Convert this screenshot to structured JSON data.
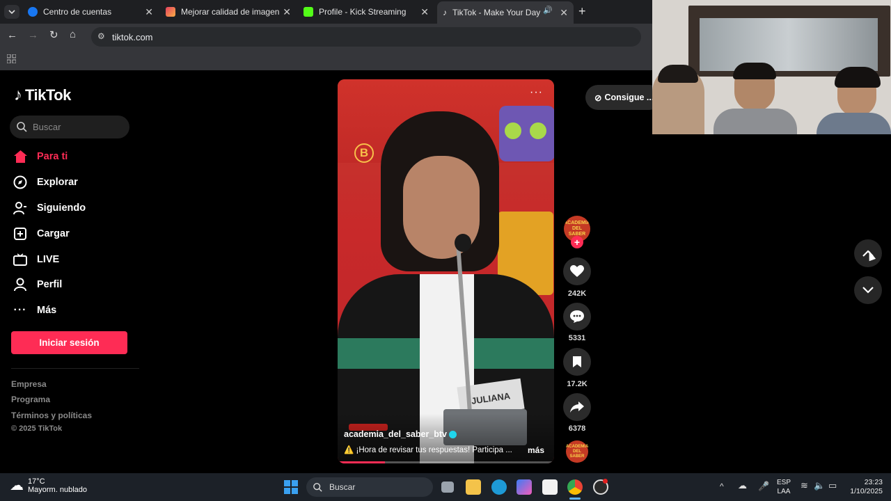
{
  "browser": {
    "tabs": [
      {
        "title": "Centro de cuentas",
        "favicon_color": "#1877f2"
      },
      {
        "title": "Mejorar calidad de imagen onli",
        "favicon_color": "#e4405f"
      },
      {
        "title": "Profile - Kick Streaming",
        "favicon_color": "#53fc18"
      },
      {
        "title": "TikTok - Make Your Day",
        "favicon_color": "#ffffff"
      }
    ],
    "new_tab": "+",
    "url": "tiktok.com"
  },
  "tiktok": {
    "logo_text": "TikTok",
    "search_placeholder": "Buscar",
    "nav": [
      {
        "label": "Para ti",
        "icon": "home-icon",
        "active": true
      },
      {
        "label": "Explorar",
        "icon": "compass-icon"
      },
      {
        "label": "Siguiendo",
        "icon": "user-follow-icon"
      },
      {
        "label": "Cargar",
        "icon": "upload-icon"
      },
      {
        "label": "LIVE",
        "icon": "live-tv-icon"
      },
      {
        "label": "Perfil",
        "icon": "profile-icon"
      },
      {
        "label": "Más",
        "icon": "more-icon"
      }
    ],
    "login_button": "Iniciar sesión",
    "footer": [
      "Empresa",
      "Programa",
      "Términos y políticas",
      "© 2025 TikTok"
    ],
    "get_app": "Consigue ...",
    "accent": "#fe2c55"
  },
  "video": {
    "username": "academia_del_saber_btv",
    "caption": "⚠️ ¡Hora de revisar tus respuestas! Participa ...",
    "more": "más",
    "badge_text": "ACADEMIA DEL SABER",
    "name_tag": "JULIANA",
    "likes": "242K",
    "comments": "5331",
    "saves": "17.2K",
    "shares": "6378"
  },
  "taskbar": {
    "weather_temp": "17°C",
    "weather_desc": "Mayorm. nublado",
    "search": "Buscar",
    "lang": "ESP",
    "lang2": "LAA",
    "time": "23:23",
    "date": "1/10/2025"
  }
}
